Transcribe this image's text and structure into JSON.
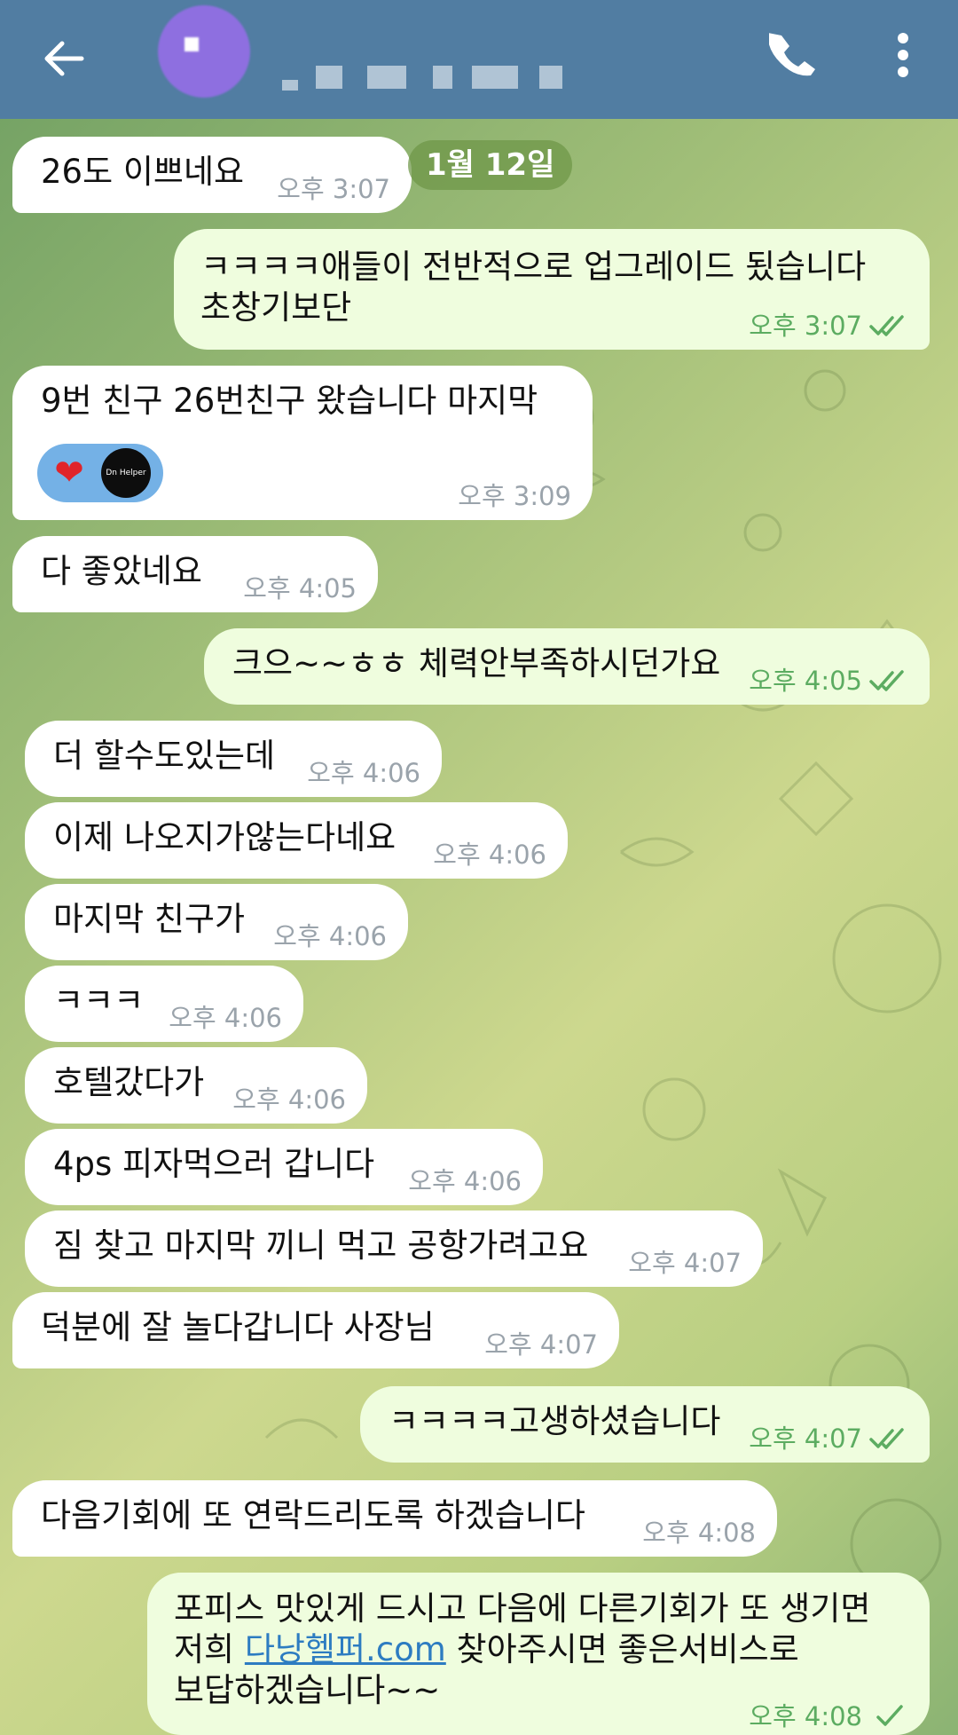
{
  "header": {
    "back_icon": "arrow-left-icon",
    "call_icon": "phone-icon",
    "menu_icon": "more-vertical-icon",
    "colors": {
      "header_bg": "#517da2",
      "incoming_bubble": "#ffffff",
      "outgoing_bubble": "#effdde",
      "outgoing_time": "#5cac61",
      "link": "#2d7cc1"
    }
  },
  "date_pill": "1월 12일",
  "messages": [
    {
      "text": "26도 이쁘네요",
      "time": "오후 3:07"
    },
    {
      "line1": "ㅋㅋㅋㅋ애들이 전반적으로 업그레이드 됬습니다",
      "line2": "초창기보단",
      "time": "오후 3:07"
    },
    {
      "text": "9번 친구 26번친구 왔습니다 마지막",
      "time": "오후 3:09",
      "reaction_heart": "❤",
      "reaction_avatar": "Dn Helper"
    },
    {
      "text": "다 좋았네요",
      "time": "오후 4:05"
    },
    {
      "text": "크으~~ㅎㅎ 체력안부족하시던가요",
      "time": "오후 4:05"
    },
    {
      "text": "더 할수도있는데",
      "time": "오후 4:06"
    },
    {
      "text": "이제 나오지가않는다네요",
      "time": "오후 4:06"
    },
    {
      "text": "마지막 친구가",
      "time": "오후 4:06"
    },
    {
      "text": "ㅋㅋㅋ",
      "time": "오후 4:06"
    },
    {
      "text": "호텔갔다가",
      "time": "오후 4:06"
    },
    {
      "text": "4ps 피자먹으러 갑니다",
      "time": "오후 4:06"
    },
    {
      "text": "짐 찾고 마지막 끼니 먹고 공항가려고요",
      "time": "오후 4:07"
    },
    {
      "text": "덕분에 잘 놀다갑니다 사장님",
      "time": "오후 4:07"
    },
    {
      "text": "ㅋㅋㅋㅋ고생하셨습니다",
      "time": "오후 4:07"
    },
    {
      "text": "다음기회에 또 연락드리도록 하겠습니다",
      "time": "오후 4:08"
    },
    {
      "line1": "포피스 맛있게 드시고 다음에 다른기회가 또 생기면",
      "line2_pre": "저희 ",
      "link": "다낭헬퍼.com",
      "line2_post": " 찾아주시면 좋은서비스로",
      "line3": "보답하겠습니다~~",
      "time": "오후 4:08"
    }
  ]
}
